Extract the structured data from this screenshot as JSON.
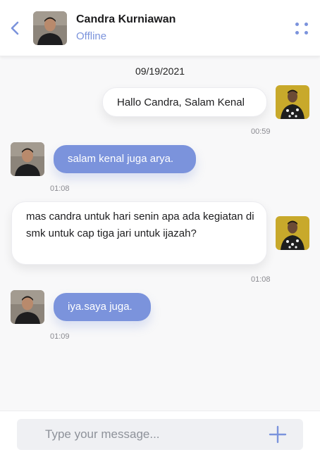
{
  "header": {
    "contact_name": "Candra Kurniawan",
    "contact_status": "Offline"
  },
  "chat": {
    "date": "09/19/2021",
    "messages": [
      {
        "direction": "outgoing",
        "text": "Hallo Candra, Salam Kenal",
        "time": "00:59"
      },
      {
        "direction": "incoming",
        "text": "salam kenal juga arya.",
        "time": "01:08"
      },
      {
        "direction": "outgoing",
        "text": "mas candra untuk hari senin apa ada kegiatan di smk untuk cap tiga jari untuk ijazah?",
        "time": "01:08"
      },
      {
        "direction": "incoming",
        "text": "iya.saya juga.",
        "time": "01:09"
      }
    ]
  },
  "composer": {
    "placeholder": "Type your message..."
  },
  "icons": {
    "back": "chevron-left-icon",
    "menu": "dots-grid-icon",
    "add": "plus-icon"
  },
  "colors": {
    "accent": "#7b93dc",
    "incoming_bubble": "#7b93dc",
    "outgoing_bubble": "#ffffff",
    "background": "#f8f8f9"
  }
}
